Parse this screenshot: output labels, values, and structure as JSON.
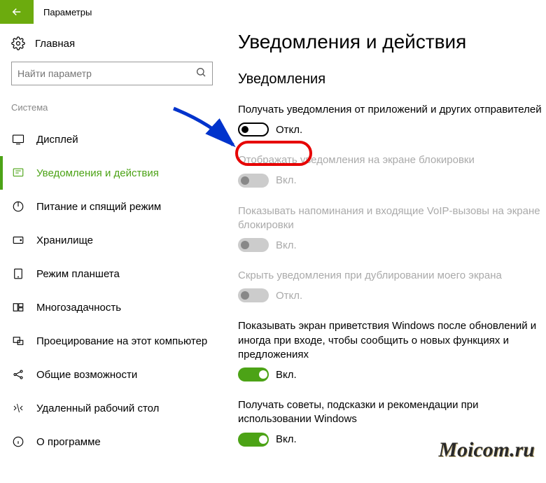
{
  "titlebar": {
    "title": "Параметры"
  },
  "sidebar": {
    "home": "Главная",
    "search_placeholder": "Найти параметр",
    "section": "Система",
    "items": [
      {
        "label": "Дисплей"
      },
      {
        "label": "Уведомления и действия"
      },
      {
        "label": "Питание и спящий режим"
      },
      {
        "label": "Хранилище"
      },
      {
        "label": "Режим планшета"
      },
      {
        "label": "Многозадачность"
      },
      {
        "label": "Проецирование на этот компьютер"
      },
      {
        "label": "Общие возможности"
      },
      {
        "label": "Удаленный рабочий стол"
      },
      {
        "label": "О программе"
      }
    ]
  },
  "main": {
    "title": "Уведомления и действия",
    "section": "Уведомления",
    "settings": [
      {
        "label": "Получать уведомления от приложений и других отправителей",
        "state": "Откл."
      },
      {
        "label": "Отображать уведомления на экране блокировки",
        "state": "Вкл."
      },
      {
        "label": "Показывать напоминания и входящие VoIP-вызовы на экране блокировки",
        "state": "Вкл."
      },
      {
        "label": "Скрыть уведомления при дублировании моего экрана",
        "state": "Откл."
      },
      {
        "label": "Показывать экран приветствия Windows после обновлений и иногда при входе, чтобы сообщить о новых функциях и предложениях",
        "state": "Вкл."
      },
      {
        "label": "Получать советы, подсказки и рекомендации при использовании Windows",
        "state": "Вкл."
      }
    ]
  },
  "watermark": "Moicom.ru"
}
